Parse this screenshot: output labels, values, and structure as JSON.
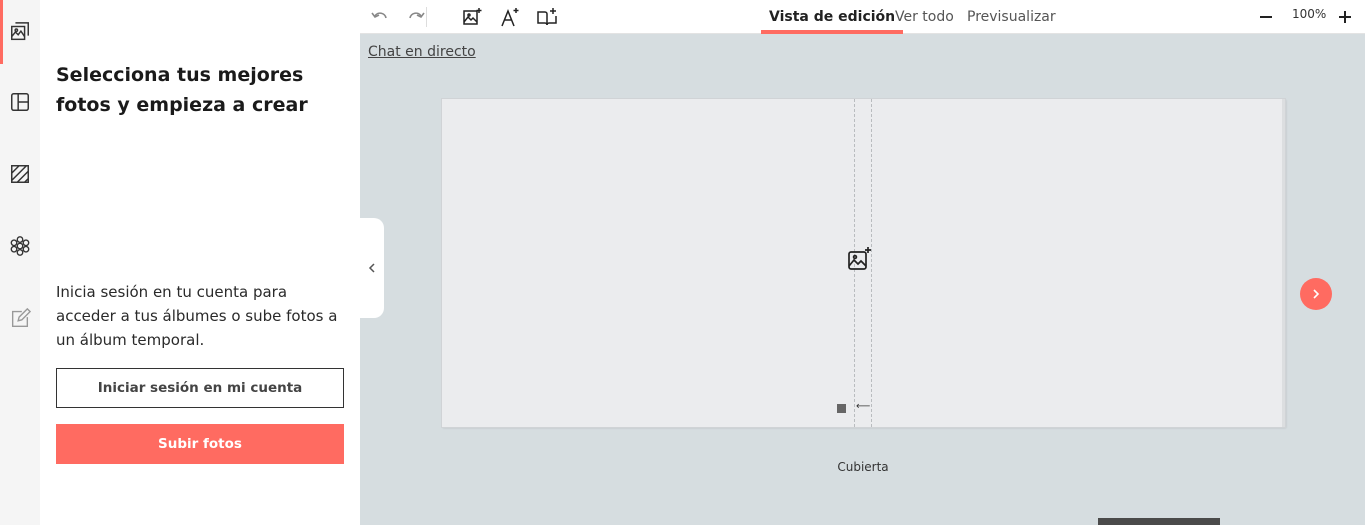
{
  "rail": {
    "items": [
      {
        "icon": "photos-icon",
        "active": true
      },
      {
        "icon": "layout-icon",
        "active": false
      },
      {
        "icon": "background-pattern-icon",
        "active": false
      },
      {
        "icon": "decoration-flower-icon",
        "active": false
      },
      {
        "icon": "edit-text-icon",
        "active": false
      }
    ]
  },
  "panel": {
    "title": "Selecciona tus mejores fotos y empieza a crear",
    "description": "Inicia sesión en tu cuenta para acceder a tus álbumes o sube fotos a un álbum temporal.",
    "login_button": "Iniciar sesión en mi cuenta",
    "upload_button": "Subir fotos"
  },
  "toolbar": {
    "tabs": [
      {
        "label": "Vista de edición",
        "active": true
      },
      {
        "label": "Ver todo",
        "active": false
      },
      {
        "label": "Previsualizar",
        "active": false
      }
    ],
    "zoom": "100%"
  },
  "chat_link": "Chat en directo",
  "canvas": {
    "page_label": "Cubierta"
  },
  "colors": {
    "accent": "#ff6b61",
    "workspace": "#d6dde0"
  }
}
